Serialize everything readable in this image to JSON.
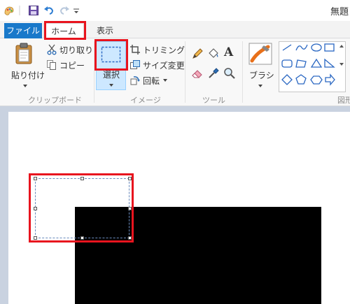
{
  "titlebar": {
    "title": "無題"
  },
  "tabs": {
    "file": "ファイル",
    "home": "ホーム",
    "view": "表示"
  },
  "ribbon": {
    "clipboard": {
      "paste_label": "貼り付け",
      "cut_label": "切り取り",
      "copy_label": "コピー",
      "group_label": "クリップボード"
    },
    "image": {
      "select_label": "選択",
      "crop_label": "トリミング",
      "resize_label": "サイズ変更",
      "rotate_label": "回転",
      "group_label": "イメージ"
    },
    "tools": {
      "group_label": "ツール",
      "text_tool": "A"
    },
    "brushes": {
      "label": "ブラシ"
    },
    "shapes": {
      "group_label": "図形"
    }
  },
  "colors": {
    "file_tab": "#1979ca",
    "highlight": "#e8141e",
    "selected_button": "#cde8ff",
    "workspace": "#c9d2e0"
  }
}
